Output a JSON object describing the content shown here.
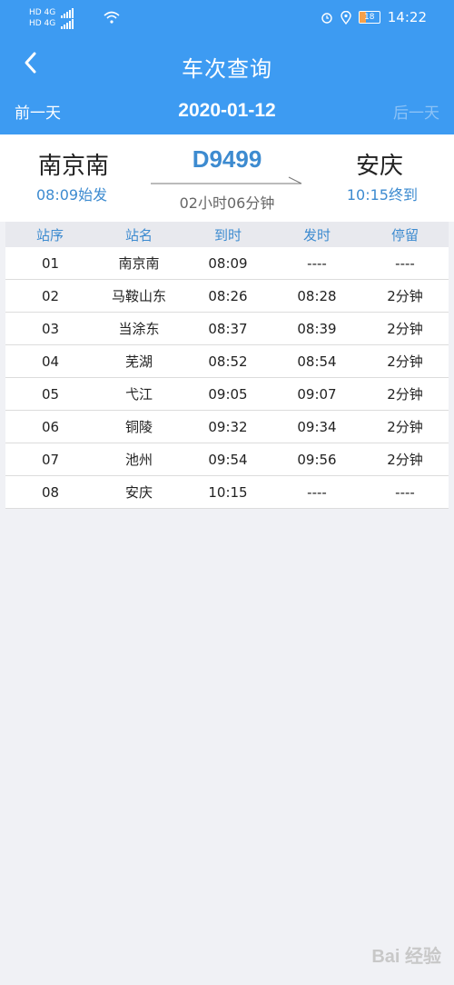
{
  "status_bar": {
    "left_top": "HD 4G",
    "left_bottom": "HD 4G",
    "battery": "18",
    "time": "14:22"
  },
  "title_bar": {
    "title": "车次查询"
  },
  "date_bar": {
    "prev_label": "前一天",
    "date": "2020-01-12",
    "next_label": "后一天"
  },
  "train": {
    "from_station": "南京南",
    "from_time": "08:09始发",
    "number": "D9499",
    "duration": "02小时06分钟",
    "to_station": "安庆",
    "to_time": "10:15终到"
  },
  "table": {
    "headers": [
      "站序",
      "站名",
      "到时",
      "发时",
      "停留"
    ],
    "rows": [
      {
        "seq": "01",
        "name": "南京南",
        "arrive": "08:09",
        "depart": "----",
        "stay": "----"
      },
      {
        "seq": "02",
        "name": "马鞍山东",
        "arrive": "08:26",
        "depart": "08:28",
        "stay": "2分钟"
      },
      {
        "seq": "03",
        "name": "当涂东",
        "arrive": "08:37",
        "depart": "08:39",
        "stay": "2分钟"
      },
      {
        "seq": "04",
        "name": "芜湖",
        "arrive": "08:52",
        "depart": "08:54",
        "stay": "2分钟"
      },
      {
        "seq": "05",
        "name": "弋江",
        "arrive": "09:05",
        "depart": "09:07",
        "stay": "2分钟"
      },
      {
        "seq": "06",
        "name": "铜陵",
        "arrive": "09:32",
        "depart": "09:34",
        "stay": "2分钟"
      },
      {
        "seq": "07",
        "name": "池州",
        "arrive": "09:54",
        "depart": "09:56",
        "stay": "2分钟"
      },
      {
        "seq": "08",
        "name": "安庆",
        "arrive": "10:15",
        "depart": "----",
        "stay": "----"
      }
    ]
  },
  "watermark": "Bai 经验",
  "icons": {
    "back": "chevron-left-icon",
    "wifi": "wifi-icon",
    "alarm": "alarm-icon",
    "location": "location-icon",
    "battery": "battery-icon"
  },
  "colors": {
    "header": "#3d9bf2",
    "accent": "#3d8bd0",
    "background": "#f0f1f5"
  }
}
